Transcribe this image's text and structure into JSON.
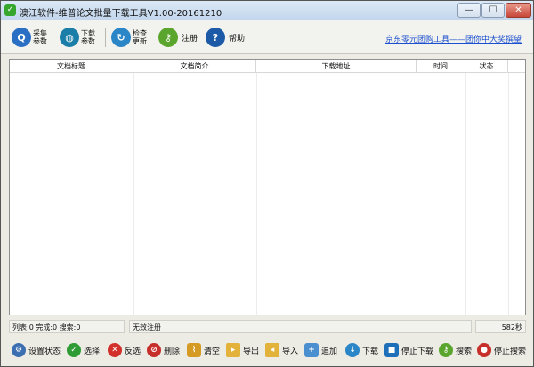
{
  "window": {
    "title": "澳江软件-维普论文批量下载工具V1.00-20161210",
    "minimize": "—",
    "maximize": "☐",
    "close": "✕"
  },
  "toolbar": {
    "items": [
      {
        "label_1": "采集",
        "label_2": "参数",
        "icon": "search-gear-icon",
        "color": "#2a6fc4"
      },
      {
        "label_1": "下载",
        "label_2": "参数",
        "icon": "globe-icon",
        "color": "#1b7ea8"
      },
      {
        "label_1": "检查",
        "label_2": "更新",
        "icon": "refresh-icon",
        "color": "#2b86c8"
      },
      {
        "label": "注册",
        "icon": "key-icon",
        "color": "#5aa52d"
      },
      {
        "label": "帮助",
        "icon": "help-icon",
        "color": "#1c5aa8"
      }
    ],
    "link": "京东零元团购工具——团你中大奖撰望"
  },
  "table": {
    "columns": [
      "文档标题",
      "文档简介",
      "下载地址",
      "时间",
      "状态"
    ]
  },
  "status": {
    "counts": "列表:0 完成:0 搜索:0",
    "register": "无效注册",
    "timer": "582秒"
  },
  "bottom": {
    "items": [
      {
        "label": "设置状态",
        "icon": "settings-icon",
        "color": "#3c6fb2"
      },
      {
        "label": "选择",
        "icon": "check-icon",
        "color": "#2e9b35"
      },
      {
        "label": "反选",
        "icon": "cross-icon",
        "color": "#d2302a"
      },
      {
        "label": "删除",
        "icon": "delete-icon",
        "color": "#c62f2a"
      },
      {
        "label": "清空",
        "icon": "broom-icon",
        "color": "#d59a22"
      },
      {
        "label": "导出",
        "icon": "export-folder-icon",
        "color": "#e3b23a"
      },
      {
        "label": "导入",
        "icon": "import-folder-icon",
        "color": "#e3b23a"
      },
      {
        "label": "追加",
        "icon": "append-icon",
        "color": "#4a8fd0"
      },
      {
        "label": "下载",
        "icon": "download-icon",
        "color": "#2b86c8"
      },
      {
        "label": "停止下载",
        "icon": "stop-download-icon",
        "color": "#1c6fb8"
      },
      {
        "label": "搜索",
        "icon": "search-key-icon",
        "color": "#5aa52d"
      },
      {
        "label": "停止搜索",
        "icon": "stop-search-icon",
        "color": "#c62f2a"
      }
    ]
  }
}
